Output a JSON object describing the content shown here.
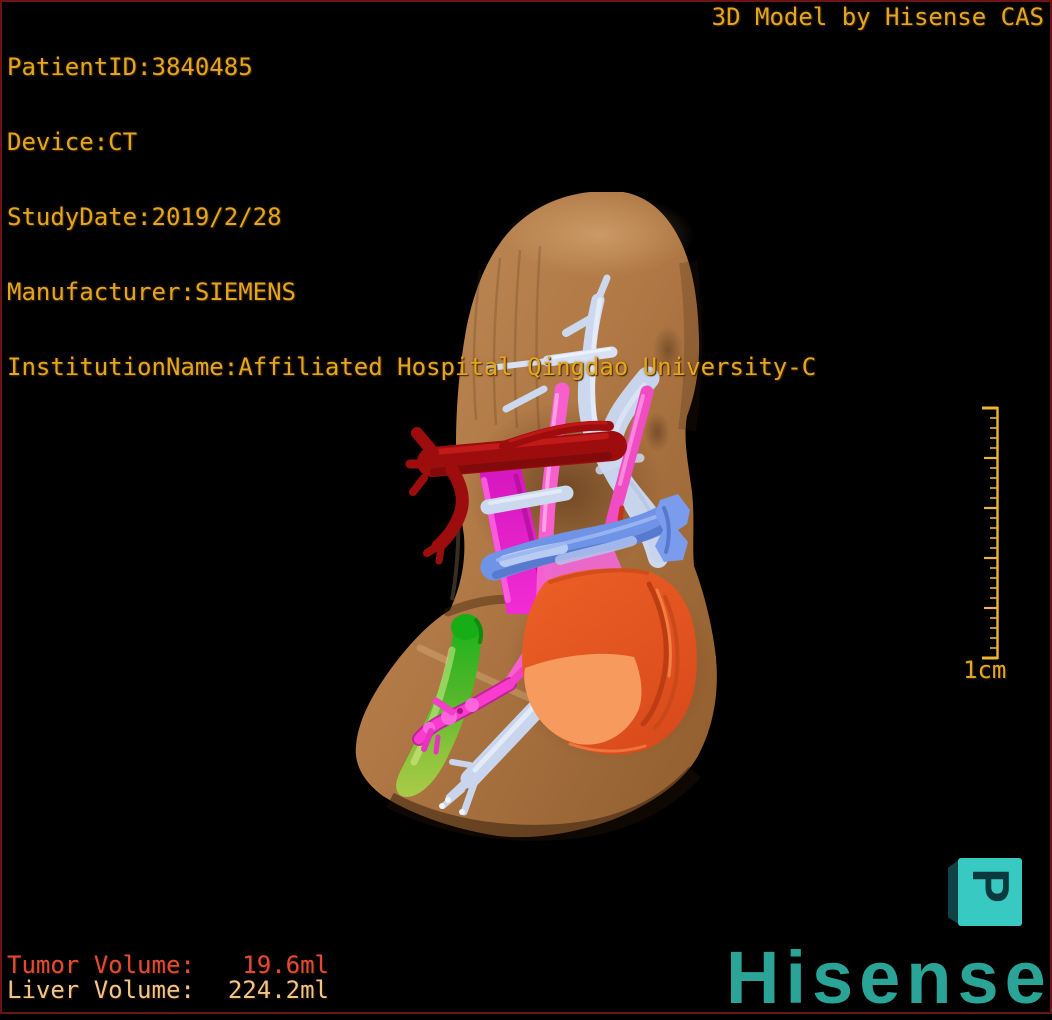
{
  "header": {
    "patient_lines": [
      "PatientID:3840485",
      "Device:CT",
      "StudyDate:2019/2/28",
      "Manufacturer:SIEMENS",
      "InstitutionName:Affiliated Hospital Qingdao University-C"
    ],
    "title": "3D Model by Hisense CAS",
    "text_color": "#e1a81f"
  },
  "scene": {
    "structures": [
      {
        "name": "liver",
        "color": "#b07946"
      },
      {
        "name": "hepatic-veins",
        "color": "#ccd8ee"
      },
      {
        "name": "hepatic-artery",
        "color": "#9d0d0d"
      },
      {
        "name": "portal-vein",
        "color": "#ee22cc"
      },
      {
        "name": "portal-branch-blue",
        "color": "#6f93e6"
      },
      {
        "name": "tumor",
        "color": "#e5541f"
      },
      {
        "name": "gallbladder",
        "color": "#55b82b"
      }
    ],
    "scale_bar": {
      "label": "1cm",
      "color": "#ecb43a"
    },
    "orientation_marker": {
      "letter": "P",
      "face_color": "#38c9c3"
    }
  },
  "footer": {
    "stats": [
      {
        "label": "Tumor Volume:",
        "value": "19.6ml",
        "color": "#e24b33"
      },
      {
        "label": "Liver Volume:",
        "value": "224.2ml",
        "color": "#eec787"
      }
    ],
    "brand": "Hisense",
    "brand_color": "#2aa496"
  }
}
